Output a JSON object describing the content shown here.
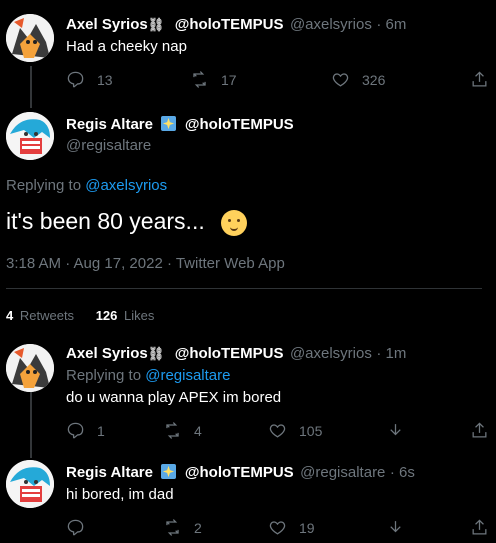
{
  "tweets": [
    {
      "name": "Axel Syrios",
      "name_emoji": "⛓",
      "display_tag": "@holoTEMPUS",
      "handle": "@axelsyrios",
      "time": "· 6m",
      "text": "Had a cheeky nap",
      "actions": {
        "replies": "13",
        "retweets": "17",
        "likes": "326"
      }
    },
    {
      "name": "Regis Altare",
      "display_tag": "@holoTEMPUS",
      "handle": "@regisaltare",
      "replying_label": "Replying to ",
      "replying_to": "@axelsyrios",
      "text": "it's been 80 years...",
      "text_emoji": "old-man-emoji",
      "meta": "3:18 AM · Aug 17, 2022 · Twitter Web App",
      "stats": {
        "retweets_count": "4",
        "retweets_label": "Retweets",
        "likes_count": "126",
        "likes_label": "Likes"
      }
    },
    {
      "name": "Axel Syrios",
      "name_emoji": "⛓",
      "display_tag": "@holoTEMPUS",
      "handle": "@axelsyrios",
      "time": "· 1m",
      "replying_label": "Replying to ",
      "replying_to": "@regisaltare",
      "text": "do u wanna play APEX im bored",
      "actions": {
        "replies": "1",
        "retweets": "4",
        "likes": "105"
      }
    },
    {
      "name": "Regis Altare",
      "display_tag": "@holoTEMPUS",
      "handle": "@regisaltare",
      "time": "· 6s",
      "text": "hi bored, im dad",
      "actions": {
        "replies": "",
        "retweets": "2",
        "likes": "19"
      }
    }
  ],
  "colors": {
    "background": "#000000",
    "accent": "#1d9bf0",
    "muted": "#6e767d",
    "divider": "#2f3336"
  }
}
